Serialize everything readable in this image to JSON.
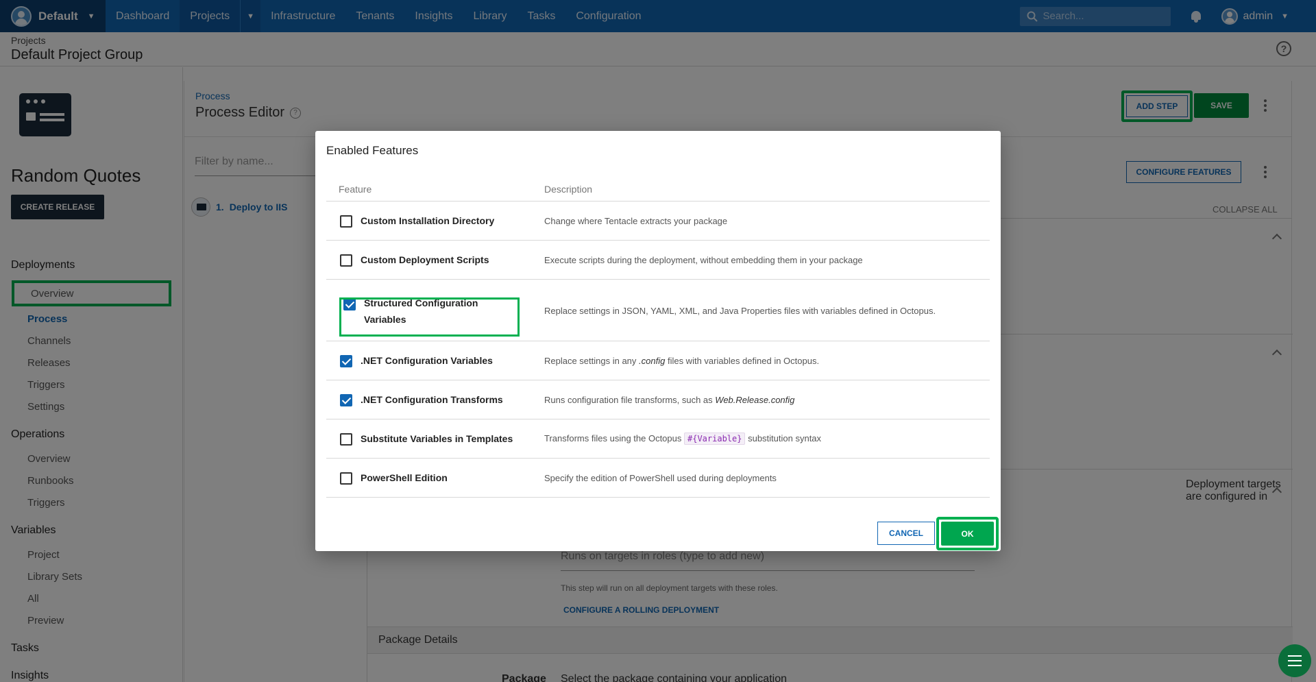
{
  "topnav": {
    "space": "Default",
    "items": [
      "Dashboard",
      "Projects",
      "Infrastructure",
      "Tenants",
      "Insights",
      "Library",
      "Tasks",
      "Configuration"
    ],
    "search_placeholder": "Search...",
    "user": "admin"
  },
  "page_header": {
    "breadcrumb": "Projects",
    "title": "Default Project Group"
  },
  "sidebar": {
    "project_name": "Random Quotes",
    "create_release": "CREATE RELEASE",
    "deployments_heading": "Deployments",
    "deployments_items": [
      "Overview",
      "Process",
      "Channels",
      "Releases",
      "Triggers",
      "Settings"
    ],
    "operations_heading": "Operations",
    "operations_items": [
      "Overview",
      "Runbooks",
      "Triggers"
    ],
    "variables_heading": "Variables",
    "variables_items": [
      "Project",
      "Library Sets",
      "All",
      "Preview"
    ],
    "tasks_heading": "Tasks",
    "insights_heading": "Insights"
  },
  "process": {
    "breadcrumb": "Process",
    "title": "Process Editor",
    "add_step": "ADD STEP",
    "save": "SAVE",
    "filter_placeholder": "Filter by name...",
    "step_number": "1.",
    "step_name": "Deploy to IIS",
    "configure_features": "CONFIGURE FEATURES",
    "collapse_all": "COLLAPSE ALL",
    "targets_text": "Deployment targets are configured in",
    "roles_placeholder": "Runs on targets in roles (type to add new)",
    "roles_hint": "This step will run on all deployment targets with these roles.",
    "rolling_link": "CONFIGURE A ROLLING DEPLOYMENT",
    "package_details": "Package Details",
    "package_label": "Package",
    "package_desc": "Select the package containing your application"
  },
  "dialog": {
    "title": "Enabled Features",
    "col_feature": "Feature",
    "col_description": "Description",
    "features": [
      {
        "label": "Custom Installation Directory",
        "checked": false,
        "desc": "Change where Tentacle extracts your package"
      },
      {
        "label": "Custom Deployment Scripts",
        "checked": false,
        "desc": "Execute scripts during the deployment, without embedding them in your package"
      },
      {
        "label": "Structured Configuration Variables",
        "checked": true,
        "desc": "Replace settings in JSON, YAML, XML, and Java Properties files with variables defined in Octopus."
      },
      {
        "label": ".NET Configuration Variables",
        "checked": true,
        "desc_pre": "Replace settings in any ",
        "desc_em": ".config",
        "desc_post": " files with variables defined in Octopus."
      },
      {
        "label": ".NET Configuration Transforms",
        "checked": true,
        "desc_pre": "Runs configuration file transforms, such as ",
        "desc_em": "Web.Release.config",
        "desc_post": ""
      },
      {
        "label": "Substitute Variables in Templates",
        "checked": false,
        "desc_pre": "Transforms files using the Octopus ",
        "desc_code": "#{Variable}",
        "desc_post": " substitution syntax"
      },
      {
        "label": "PowerShell Edition",
        "checked": false,
        "desc": "Specify the edition of PowerShell used during deployments"
      }
    ],
    "cancel": "CANCEL",
    "ok": "OK"
  },
  "colors": {
    "nav_blue": "#1166b3",
    "nav_dark": "#0d3e6e",
    "highlight_green": "#00b050",
    "save_green": "#008a3c"
  }
}
